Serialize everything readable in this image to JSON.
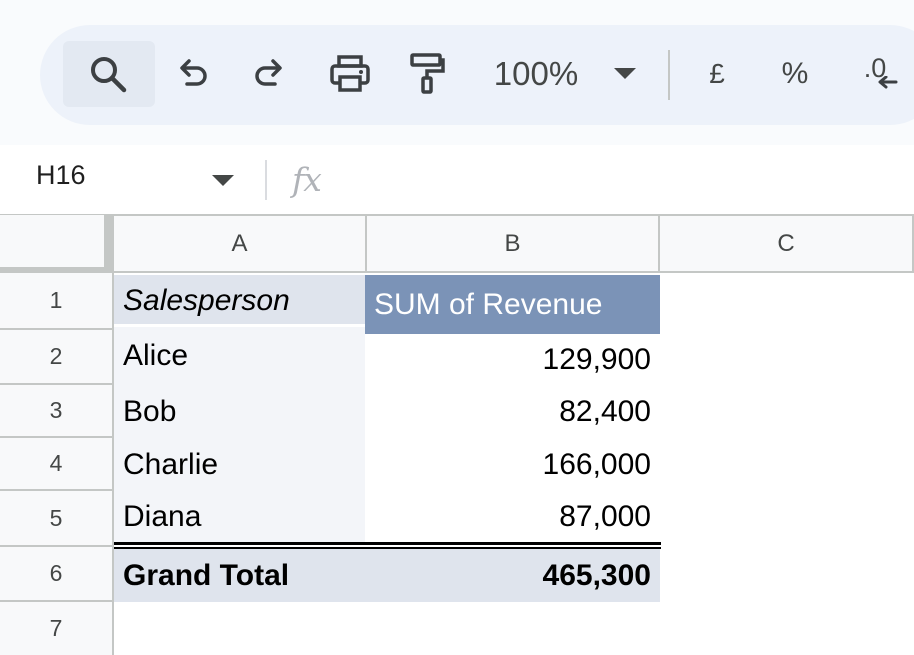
{
  "toolbar": {
    "zoom": "100%",
    "currency_symbol": "£",
    "percent_symbol": "%",
    "decrease_decimal_label": ".0"
  },
  "formula_bar": {
    "cell_reference": "H16",
    "fx_label": "fx"
  },
  "columns": [
    "A",
    "B",
    "C"
  ],
  "rows": [
    "1",
    "2",
    "3",
    "4",
    "5",
    "6",
    "7"
  ],
  "pivot": {
    "header": {
      "label": "Salesperson",
      "value": "SUM of Revenue"
    },
    "items": [
      {
        "label": "Alice",
        "value": "129,900"
      },
      {
        "label": "Bob",
        "value": "82,400"
      },
      {
        "label": "Charlie",
        "value": "166,000"
      },
      {
        "label": "Diana",
        "value": "87,000"
      }
    ],
    "total": {
      "label": "Grand Total",
      "value": "465,300"
    }
  },
  "colors": {
    "pivot_header_value_bg": "#7b93b7",
    "pivot_header_label_bg": "#dfe4ed",
    "pivot_row_label_bg": "#f3f5f9",
    "toolbar_bg": "#edf2fa"
  }
}
